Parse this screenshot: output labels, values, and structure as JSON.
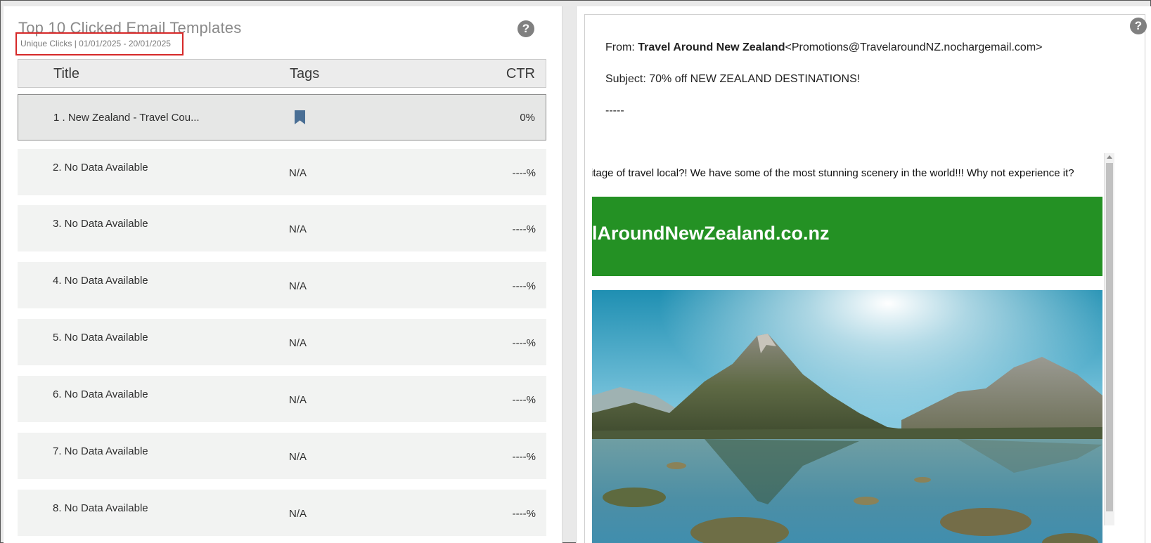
{
  "panel": {
    "title": "Top 10 Clicked Email Templates",
    "subtitle": "Unique Clicks | 01/01/2025 - 20/01/2025",
    "help_label": "?"
  },
  "table": {
    "columns": {
      "title": "Title",
      "tags": "Tags",
      "ctr": "CTR"
    },
    "rows": [
      {
        "title": "1 . New Zealand - Travel Cou...",
        "tags": "",
        "ctr": "0%"
      },
      {
        "title": "2. No Data Available",
        "tags": "N/A",
        "ctr": "----%"
      },
      {
        "title": "3. No Data Available",
        "tags": "N/A",
        "ctr": "----%"
      },
      {
        "title": "4. No Data Available",
        "tags": "N/A",
        "ctr": "----%"
      },
      {
        "title": "5. No Data Available",
        "tags": "N/A",
        "ctr": "----%"
      },
      {
        "title": "6. No Data Available",
        "tags": "N/A",
        "ctr": "----%"
      },
      {
        "title": "7. No Data Available",
        "tags": "N/A",
        "ctr": "----%"
      },
      {
        "title": "8. No Data Available",
        "tags": "N/A",
        "ctr": "----%"
      }
    ],
    "first_row_tag_icon": "bookmark-icon",
    "tag_color": "#4a6f95"
  },
  "preview": {
    "help_label": "?",
    "from_label": "From:",
    "from_name": "Travel Around New Zealand",
    "from_email": "<Promotions@TravelaroundNZ.nochargemail.com>",
    "subject": "Subject: 70% off NEW ZEALAND DESTINATIONS!",
    "separator": "-----",
    "body_text": "itage of travel local?! We have some of the most stunning scenery in the world!!! Why not experience it?",
    "banner_text": "lAroundNewZealand.co.nz",
    "banner_color": "#249124"
  }
}
